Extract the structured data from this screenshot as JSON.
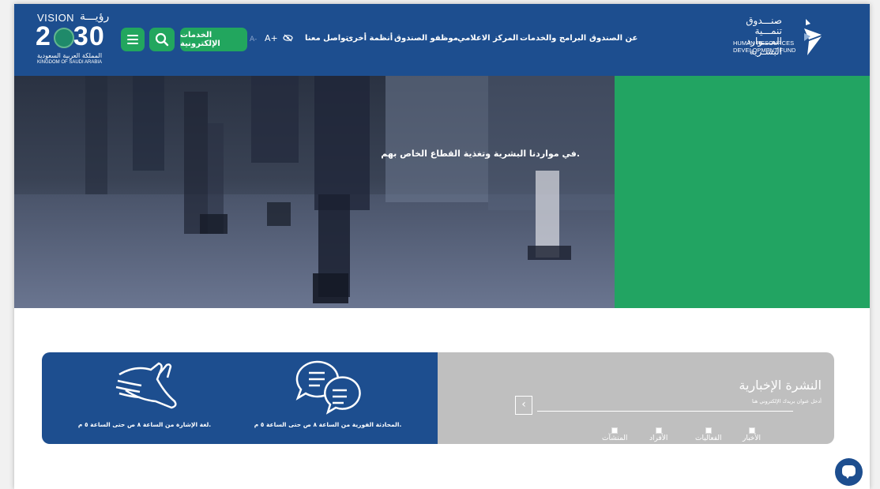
{
  "header": {
    "vision": {
      "title_en": "VISION",
      "title_ar": "رؤيـــة",
      "year_left": "2",
      "year_right": "30",
      "kingdom_ar": "المملكة العربية السعودية",
      "kingdom_en": "KINGDOM OF SAUDI ARABIA"
    },
    "e_services_label": "الخدمات الإلكترونية",
    "font_small": "A-",
    "font_large": "A+",
    "nav": [
      "عن الصندوق",
      "البرامج والخدمات",
      "المركز الاعلامي",
      "موظفو الصندوق",
      "أنظمة أخرى",
      "تواصل معنا"
    ],
    "logo": {
      "ar_line1": "صنـــدوق تنمـــية",
      "ar_line2": "المـــوارد البشـرية",
      "en_line1": "HUMAN RESOURCES",
      "en_line2": "DEVELOPMENT FUND"
    }
  },
  "hero": {
    "text": "في مواردنا البشرية وتغذية القطاع الخاص بهم."
  },
  "newsletter": {
    "title": "النشرة الإخبارية",
    "email_placeholder": "أدخل عنوان بريدك الإلكتروني هنا",
    "options": [
      "الأخبار",
      "الفعاليات",
      "الأفراد",
      "المنشآت"
    ]
  },
  "services": {
    "chat_label": "المحادثة الفورية من الساعة ٨ ص حتى الساعة ٥ م.",
    "sign_label": "لغة الإشارة من الساعة ٨ ص حتى الساعة ٥ م."
  },
  "colors": {
    "header_blue": "#1d4e8f",
    "green": "#22a462",
    "card_gray": "#bfbfbf"
  },
  "icons": [
    "hamburger-menu-icon",
    "search-icon",
    "eye-slash-icon",
    "chat-bubbles-icon",
    "sign-language-icon",
    "chat-icon"
  ]
}
